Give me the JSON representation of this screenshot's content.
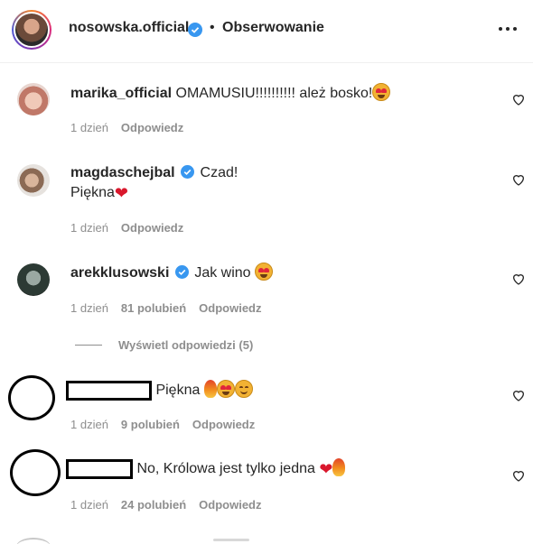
{
  "header": {
    "username": "nosowska.official",
    "separator": "•",
    "follow_label": "Obserwowanie",
    "more_icon": "more-horizontal-icon"
  },
  "colors": {
    "verified": "#3897f0",
    "text": "#262626",
    "muted": "#8e8e8e"
  },
  "comments": [
    {
      "username": "marika_official",
      "verified": false,
      "text": "OMAMUSIU!!!!!!!!!! ależ bosko!",
      "emojis": [
        "smiling-face-with-heart-eyes"
      ],
      "time": "1 dzień",
      "likes": "",
      "reply": "Odpowiedz"
    },
    {
      "username": "magdaschejbal",
      "verified": true,
      "text": "Czad!",
      "text_line2": "Piękna",
      "emojis": [
        "red-heart"
      ],
      "time": "1 dzień",
      "likes": "",
      "reply": "Odpowiedz"
    },
    {
      "username": "arekklusowski",
      "verified": true,
      "text": "Jak wino",
      "emojis": [
        "smiling-face-with-heart-eyes"
      ],
      "time": "1 dzień",
      "likes": "81 polubień",
      "reply": "Odpowiedz",
      "view_replies": "Wyświetl odpowiedzi (5)"
    },
    {
      "username": "",
      "redacted": true,
      "text": "Piękna",
      "emojis": [
        "fire",
        "smiling-face-with-heart-eyes",
        "smiling-face-with-hearts"
      ],
      "time": "1 dzień",
      "likes": "9 polubień",
      "reply": "Odpowiedz"
    },
    {
      "username": "",
      "redacted": true,
      "text": "No, Królowa jest tylko jedna",
      "emojis": [
        "red-heart",
        "fire"
      ],
      "time": "1 dzień",
      "likes": "24 polubień",
      "reply": "Odpowiedz"
    }
  ]
}
